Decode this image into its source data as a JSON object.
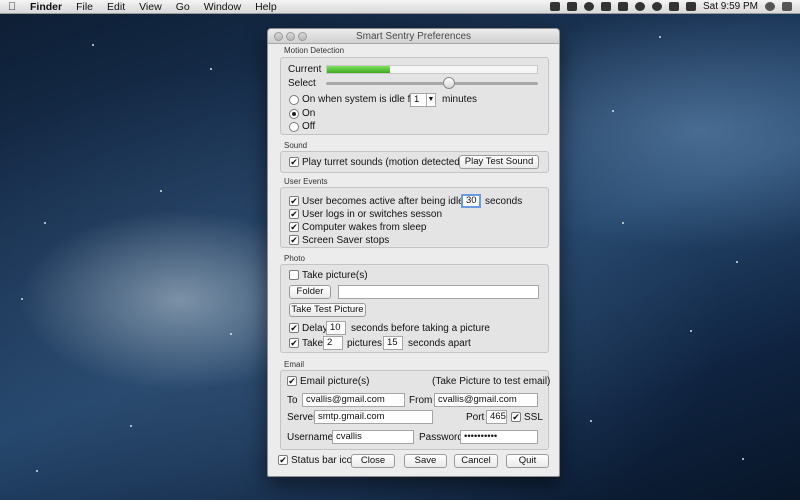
{
  "menubar": {
    "app_name": "Finder",
    "items": [
      "File",
      "Edit",
      "View",
      "Go",
      "Window",
      "Help"
    ],
    "clock": "Sat 9:59 PM"
  },
  "window": {
    "title": "Smart Sentry Preferences"
  },
  "motion": {
    "section": "Motion Detection",
    "current_label": "Current",
    "current_level": 0.3,
    "select_label": "Select",
    "select_level": 0.58,
    "idle_option_label": "On when system is idle for",
    "idle_value": "1",
    "idle_units": "minutes",
    "on_label": "On",
    "off_label": "Off"
  },
  "sound": {
    "section": "Sound",
    "turret_label": "Play turret sounds (motion detected)",
    "test_button": "Play Test Sound"
  },
  "events": {
    "section": "User Events",
    "active_prefix": "User becomes active after being idle for",
    "active_value": "30",
    "active_suffix": "seconds",
    "login_label": "User logs in or switches sesson",
    "wake_label": "Computer wakes from sleep",
    "screensaver_label": "Screen Saver stops"
  },
  "photo": {
    "section": "Photo",
    "take_pictures_label": "Take picture(s)",
    "folder_button": "Folder",
    "folder_path": "",
    "test_picture_button": "Take Test Picture",
    "delay_label": "Delay",
    "delay_value": "10",
    "delay_suffix": "seconds before taking a picture",
    "take_label": "Take",
    "take_value": "2",
    "pictures_label": "pictures",
    "apart_value": "15",
    "apart_suffix": "seconds apart"
  },
  "email": {
    "section": "Email",
    "email_pictures_label": "Email picture(s)",
    "hint": "(Take Picture to test email)",
    "to_label": "To",
    "to_value": "cvallis@gmail.com",
    "from_label": "From",
    "from_value": "cvallis@gmail.com",
    "server_label": "Server",
    "server_value": "smtp.gmail.com",
    "port_label": "Port",
    "port_value": "465",
    "ssl_label": "SSL",
    "username_label": "Username",
    "username_value": "cvallis",
    "password_label": "Password",
    "password_value": "••••••••••"
  },
  "footer": {
    "status_bar_label": "Status bar icon",
    "close_button": "Close",
    "save_button": "Save",
    "cancel_button": "Cancel",
    "quit_button": "Quit"
  },
  "colors": {
    "level_green": "#52c234",
    "focus_ring": "#6a9be0"
  }
}
